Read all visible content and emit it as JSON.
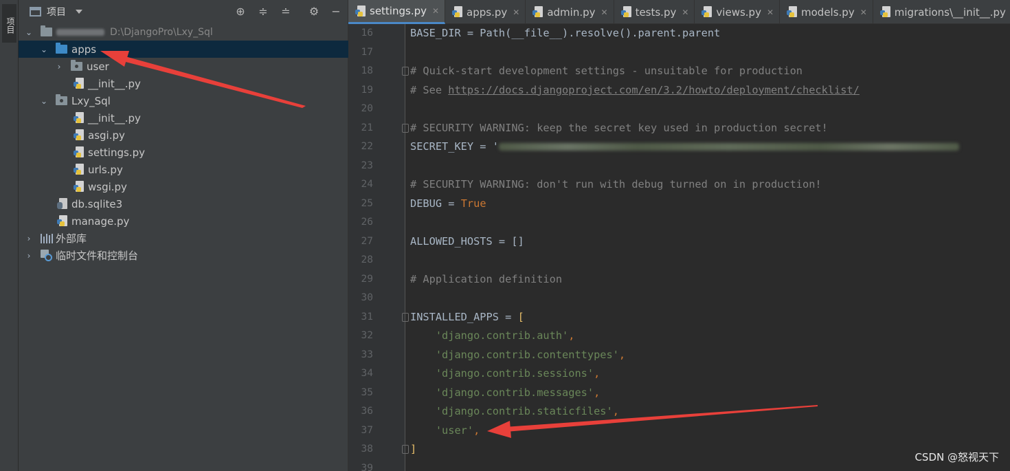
{
  "strip": {
    "tab_label": "项目"
  },
  "project": {
    "header_label": "项目",
    "tree": [
      {
        "label": "Lxy_Sql",
        "path": "D:\\DjangoPro\\Lxy_Sql"
      },
      {
        "label": "apps"
      },
      {
        "label": "user"
      },
      {
        "label": "__init__.py"
      },
      {
        "label": "Lxy_Sql"
      },
      {
        "label": "__init__.py"
      },
      {
        "label": "asgi.py"
      },
      {
        "label": "settings.py"
      },
      {
        "label": "urls.py"
      },
      {
        "label": "wsgi.py"
      },
      {
        "label": "db.sqlite3"
      },
      {
        "label": "manage.py"
      },
      {
        "label": "外部库"
      },
      {
        "label": "临时文件和控制台"
      }
    ]
  },
  "tabs": [
    {
      "label": "settings.py",
      "active": true
    },
    {
      "label": "apps.py"
    },
    {
      "label": "admin.py"
    },
    {
      "label": "tests.py"
    },
    {
      "label": "views.py"
    },
    {
      "label": "models.py"
    },
    {
      "label": "migrations\\__init__.py"
    }
  ],
  "editor": {
    "lines": [
      {
        "n": "16",
        "text": "BASE_DIR = Path(__file__).resolve().parent.parent"
      },
      {
        "n": "17",
        "text": ""
      },
      {
        "n": "18",
        "text": "# Quick-start development settings - unsuitable for production"
      },
      {
        "n": "19",
        "text_prefix": "# See ",
        "link": "https://docs.djangoproject.com/en/3.2/howto/deployment/checklist/"
      },
      {
        "n": "20",
        "text": ""
      },
      {
        "n": "21",
        "text": "# SECURITY WARNING: keep the secret key used in production secret!"
      },
      {
        "n": "22",
        "text_prefix": "SECRET_KEY = '"
      },
      {
        "n": "23",
        "text": ""
      },
      {
        "n": "24",
        "text": "# SECURITY WARNING: don't run with debug turned on in production!"
      },
      {
        "n": "25",
        "text_prefix": "DEBUG = ",
        "keyword": "True"
      },
      {
        "n": "26",
        "text": ""
      },
      {
        "n": "27",
        "text": "ALLOWED_HOSTS = []"
      },
      {
        "n": "28",
        "text": ""
      },
      {
        "n": "29",
        "text": "# Application definition"
      },
      {
        "n": "30",
        "text": ""
      },
      {
        "n": "31",
        "text_prefix": "INSTALLED_APPS = ",
        "bracket": "["
      },
      {
        "n": "32",
        "string": "'django.contrib.auth'",
        "suffix": ","
      },
      {
        "n": "33",
        "string": "'django.contrib.contenttypes'",
        "suffix": ","
      },
      {
        "n": "34",
        "string": "'django.contrib.sessions'",
        "suffix": ","
      },
      {
        "n": "35",
        "string": "'django.contrib.messages'",
        "suffix": ","
      },
      {
        "n": "36",
        "string": "'django.contrib.staticfiles'",
        "suffix": ","
      },
      {
        "n": "37",
        "string": "'user'",
        "suffix": ","
      },
      {
        "n": "38",
        "bracket": "]"
      },
      {
        "n": "39",
        "text": ""
      }
    ]
  },
  "watermark": "CSDN @怒视天下",
  "colors": {
    "accent": "#4a88c7",
    "selection": "#0d293e",
    "arrow": "#e8403a"
  }
}
